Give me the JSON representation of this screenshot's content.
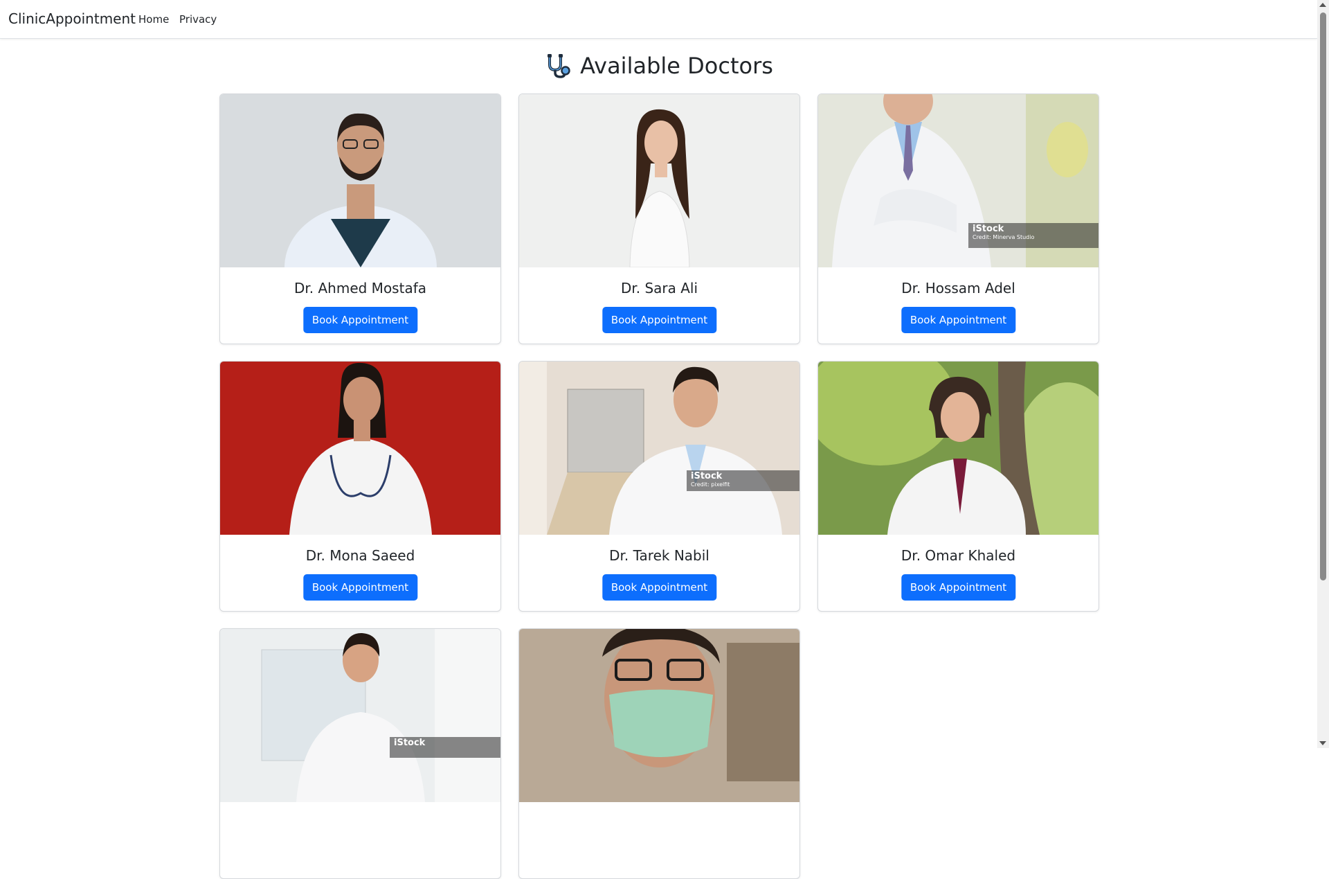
{
  "navbar": {
    "brand": "ClinicAppointment",
    "links": [
      "Home",
      "Privacy"
    ]
  },
  "page": {
    "title": "Available Doctors",
    "title_icon": "stethoscope-icon"
  },
  "book_label": "Book Appointment",
  "doctors": [
    {
      "name": "Dr. Ahmed Mostafa"
    },
    {
      "name": "Dr. Sara Ali"
    },
    {
      "name": "Dr. Hossam Adel",
      "watermark": {
        "brand": "iStock",
        "credit": "Credit: Minerva Studio"
      }
    },
    {
      "name": "Dr. Mona Saeed"
    },
    {
      "name": "Dr. Tarek Nabil",
      "watermark": {
        "brand": "iStock",
        "credit": "Credit: pixelfit"
      }
    },
    {
      "name": "Dr. Omar Khaled"
    },
    {
      "name": "",
      "watermark": {
        "brand": "iStock",
        "credit": ""
      }
    },
    {
      "name": ""
    }
  ],
  "colors": {
    "primary": "#0d6efd",
    "text": "#212529",
    "border": "#dee2e6"
  }
}
